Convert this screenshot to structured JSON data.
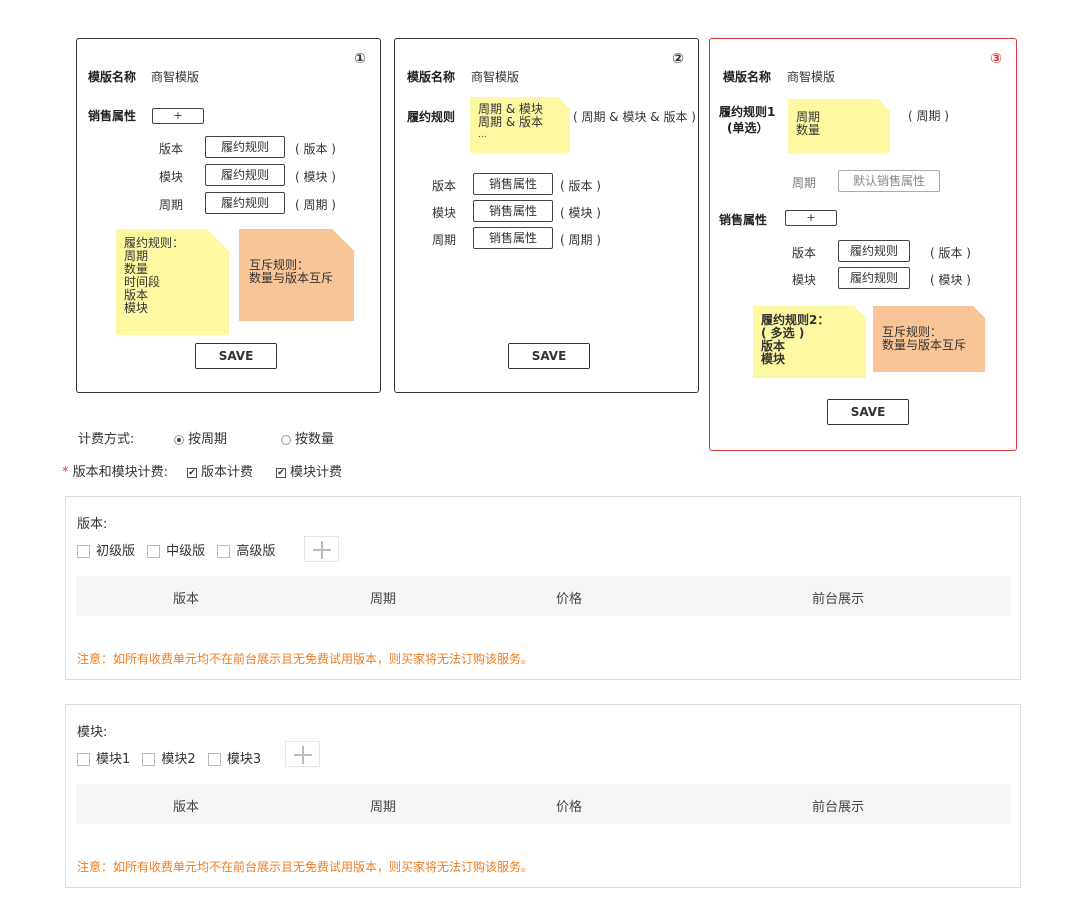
{
  "card1": {
    "num": "①",
    "tpl_name_label": "模版名称",
    "tpl_name_value": "商智模版",
    "sales_attr_label": "销售属性",
    "plus": "+",
    "rows": [
      {
        "name": "版本",
        "btn": "履约规则",
        "tag": "( 版本 )"
      },
      {
        "name": "模块",
        "btn": "履约规则",
        "tag": "( 模块 )"
      },
      {
        "name": "周期",
        "btn": "履约规则",
        "tag": "( 周期 )"
      }
    ],
    "note_yellow": [
      "履约规则：",
      "周期",
      "数量",
      "时间段",
      "版本",
      "模块"
    ],
    "note_orange": [
      "互斥规则：",
      "数量与版本互斥"
    ],
    "save": "SAVE"
  },
  "card2": {
    "num": "②",
    "tpl_name_label": "模版名称",
    "tpl_name_value": "商智模版",
    "rule_label": "履约规则",
    "note": [
      "周期 & 模块",
      "周期 & 版本",
      "..."
    ],
    "rule_tag": "( 周期 & 模块 & 版本 )",
    "rows": [
      {
        "name": "版本",
        "btn": "销售属性",
        "tag": "( 版本 )"
      },
      {
        "name": "模块",
        "btn": "销售属性",
        "tag": "( 模块 )"
      },
      {
        "name": "周期",
        "btn": "销售属性",
        "tag": "( 周期 )"
      }
    ],
    "save": "SAVE"
  },
  "card3": {
    "num": "③",
    "tpl_name_label": "模版名称",
    "tpl_name_value": "商智模版",
    "rule1_label_1": "履约规则1",
    "rule1_label_2": "(单选）",
    "rule1_note": [
      "周期",
      "数量"
    ],
    "rule1_tag": "( 周期 )",
    "period_label": "周期",
    "period_btn": "默认销售属性",
    "sales_attr_label": "销售属性",
    "plus": "+",
    "rows": [
      {
        "name": "版本",
        "btn": "履约规则",
        "tag": "( 版本 )"
      },
      {
        "name": "模块",
        "btn": "履约规则",
        "tag": "( 模块 )"
      }
    ],
    "note_yellow": [
      "履约规则2：",
      "( 多选 )",
      "版本",
      "模块"
    ],
    "note_orange": [
      "互斥规则：",
      "数量与版本互斥"
    ],
    "save": "SAVE"
  },
  "billing": {
    "label": "计费方式:",
    "opt1": "按周期",
    "opt2": "按数量",
    "req_star": "*",
    "vm_label": "版本和模块计费:",
    "chk1": "版本计费",
    "chk2": "模块计费"
  },
  "panel_version": {
    "title": "版本:",
    "options": [
      "初级版",
      "中级版",
      "高级版"
    ],
    "columns": [
      "版本",
      "周期",
      "价格",
      "前台展示"
    ],
    "warning": "注意：如所有收费单元均不在前台展示且无免费试用版本，则买家将无法订购该服务。"
  },
  "panel_module": {
    "title": "模块:",
    "options": [
      "模块1",
      "模块2",
      "模块3"
    ],
    "columns": [
      "版本",
      "周期",
      "价格",
      "前台展示"
    ],
    "warning": "注意：如所有收费单元均不在前台展示且无免费试用版本，则买家将无法订购该服务。"
  },
  "colors": {
    "red": "#d9373c",
    "warning": "#f07c21",
    "note_yellow": "#fdf9a3",
    "note_orange": "#fac596"
  }
}
